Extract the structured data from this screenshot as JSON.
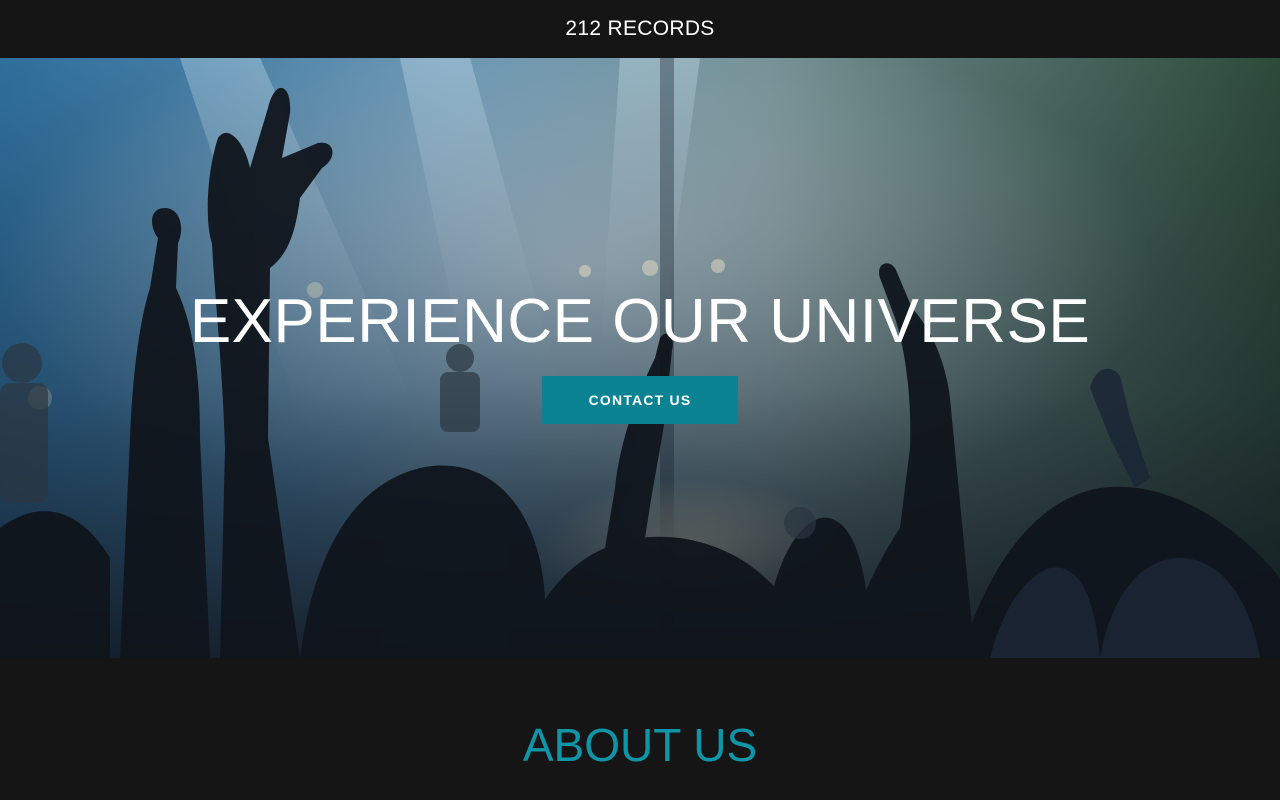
{
  "header": {
    "brand": "212 RECORDS"
  },
  "hero": {
    "headline": "EXPERIENCE OUR UNIVERSE",
    "cta_label": "CONTACT US",
    "background_image": "concert crowd with raised hands in front of a lit stage"
  },
  "about": {
    "heading": "ABOUT US"
  },
  "colors": {
    "page_bg": "#151515",
    "accent": "#0b8393",
    "about_heading": "#0e96a8",
    "text": "#ffffff"
  }
}
